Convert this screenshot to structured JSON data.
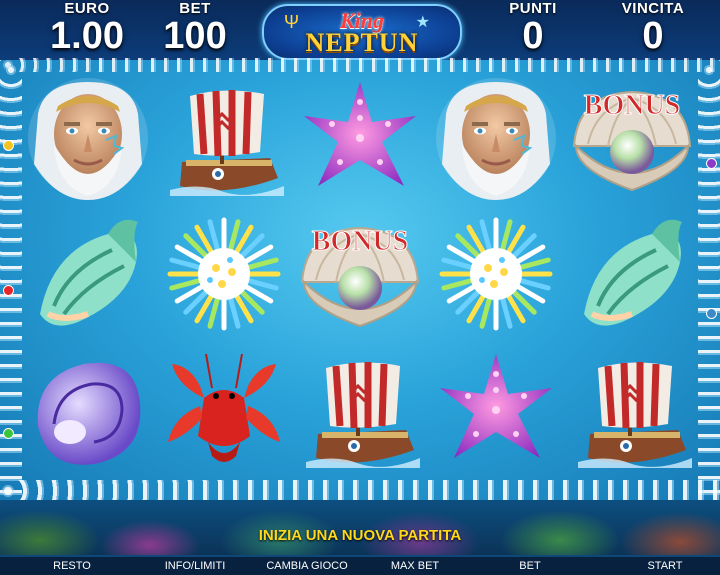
{
  "hud": {
    "euro_label": "EURO",
    "euro_value": "1.00",
    "bet_label": "BET",
    "bet_value": "100",
    "punti_label": "PUNTI",
    "punti_value": "0",
    "vincita_label": "VINCITA",
    "vincita_value": "0"
  },
  "logo": {
    "line1": "King",
    "line2": "NEPTUN"
  },
  "reels": [
    [
      "neptune",
      "conch-shell",
      "spiral-shell"
    ],
    [
      "ship",
      "sea-urchin",
      "lobster"
    ],
    [
      "starfish",
      "bonus-pearl",
      "ship"
    ],
    [
      "neptune",
      "sea-urchin",
      "starfish"
    ],
    [
      "bonus-pearl",
      "conch-shell",
      "ship"
    ]
  ],
  "bonus_text": "BONUS",
  "message": "INIZIA UNA NUOVA PARTITA",
  "buttons": {
    "resto": "RESTO",
    "info": "INFO/LIMITI",
    "cambia": "CAMBIA GIOCO",
    "maxbet": "MAX BET",
    "bet": "BET",
    "start": "START"
  },
  "colors": {
    "message": "#ffd81a",
    "logo_king": "#ff3b3b",
    "logo_neptun": "#ffd23a"
  }
}
